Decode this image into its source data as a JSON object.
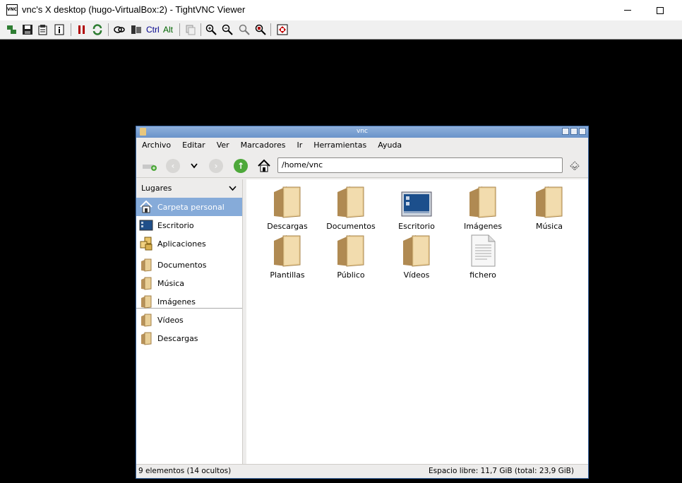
{
  "viewer": {
    "title": "vnc's X desktop (hugo-VirtualBox:2) - TightVNC Viewer",
    "toolbar": {
      "ctrl_label": "Ctrl",
      "alt_label": "Alt"
    }
  },
  "nautilus": {
    "title": "vnc",
    "menu": [
      "Archivo",
      "Editar",
      "Ver",
      "Marcadores",
      "Ir",
      "Herramientas",
      "Ayuda"
    ],
    "location": "/home/vnc",
    "sidebar": {
      "header": "Lugares",
      "items": [
        {
          "label": "Carpeta personal",
          "icon": "home-icon",
          "selected": true
        },
        {
          "label": "Escritorio",
          "icon": "desktop-icon"
        },
        {
          "label": "Aplicaciones",
          "icon": "applications-icon"
        },
        {
          "label": "Documentos",
          "icon": "folder-icon"
        },
        {
          "label": "Música",
          "icon": "folder-icon"
        },
        {
          "label": "Imágenes",
          "icon": "folder-icon"
        },
        {
          "label": "Vídeos",
          "icon": "folder-icon"
        },
        {
          "label": "Descargas",
          "icon": "folder-icon"
        }
      ]
    },
    "files": [
      {
        "label": "Descargas",
        "icon": "folder-icon"
      },
      {
        "label": "Documentos",
        "icon": "folder-icon"
      },
      {
        "label": "Escritorio",
        "icon": "desktop-icon"
      },
      {
        "label": "Imágenes",
        "icon": "folder-icon"
      },
      {
        "label": "Música",
        "icon": "folder-icon"
      },
      {
        "label": "Plantillas",
        "icon": "folder-icon"
      },
      {
        "label": "Público",
        "icon": "folder-icon"
      },
      {
        "label": "Vídeos",
        "icon": "folder-icon"
      },
      {
        "label": "fichero",
        "icon": "text-file-icon"
      }
    ],
    "status": {
      "left": "9 elementos (14 ocultos)",
      "right": "Espacio libre: 11,7 GiB (total: 23,9 GiB)"
    }
  }
}
